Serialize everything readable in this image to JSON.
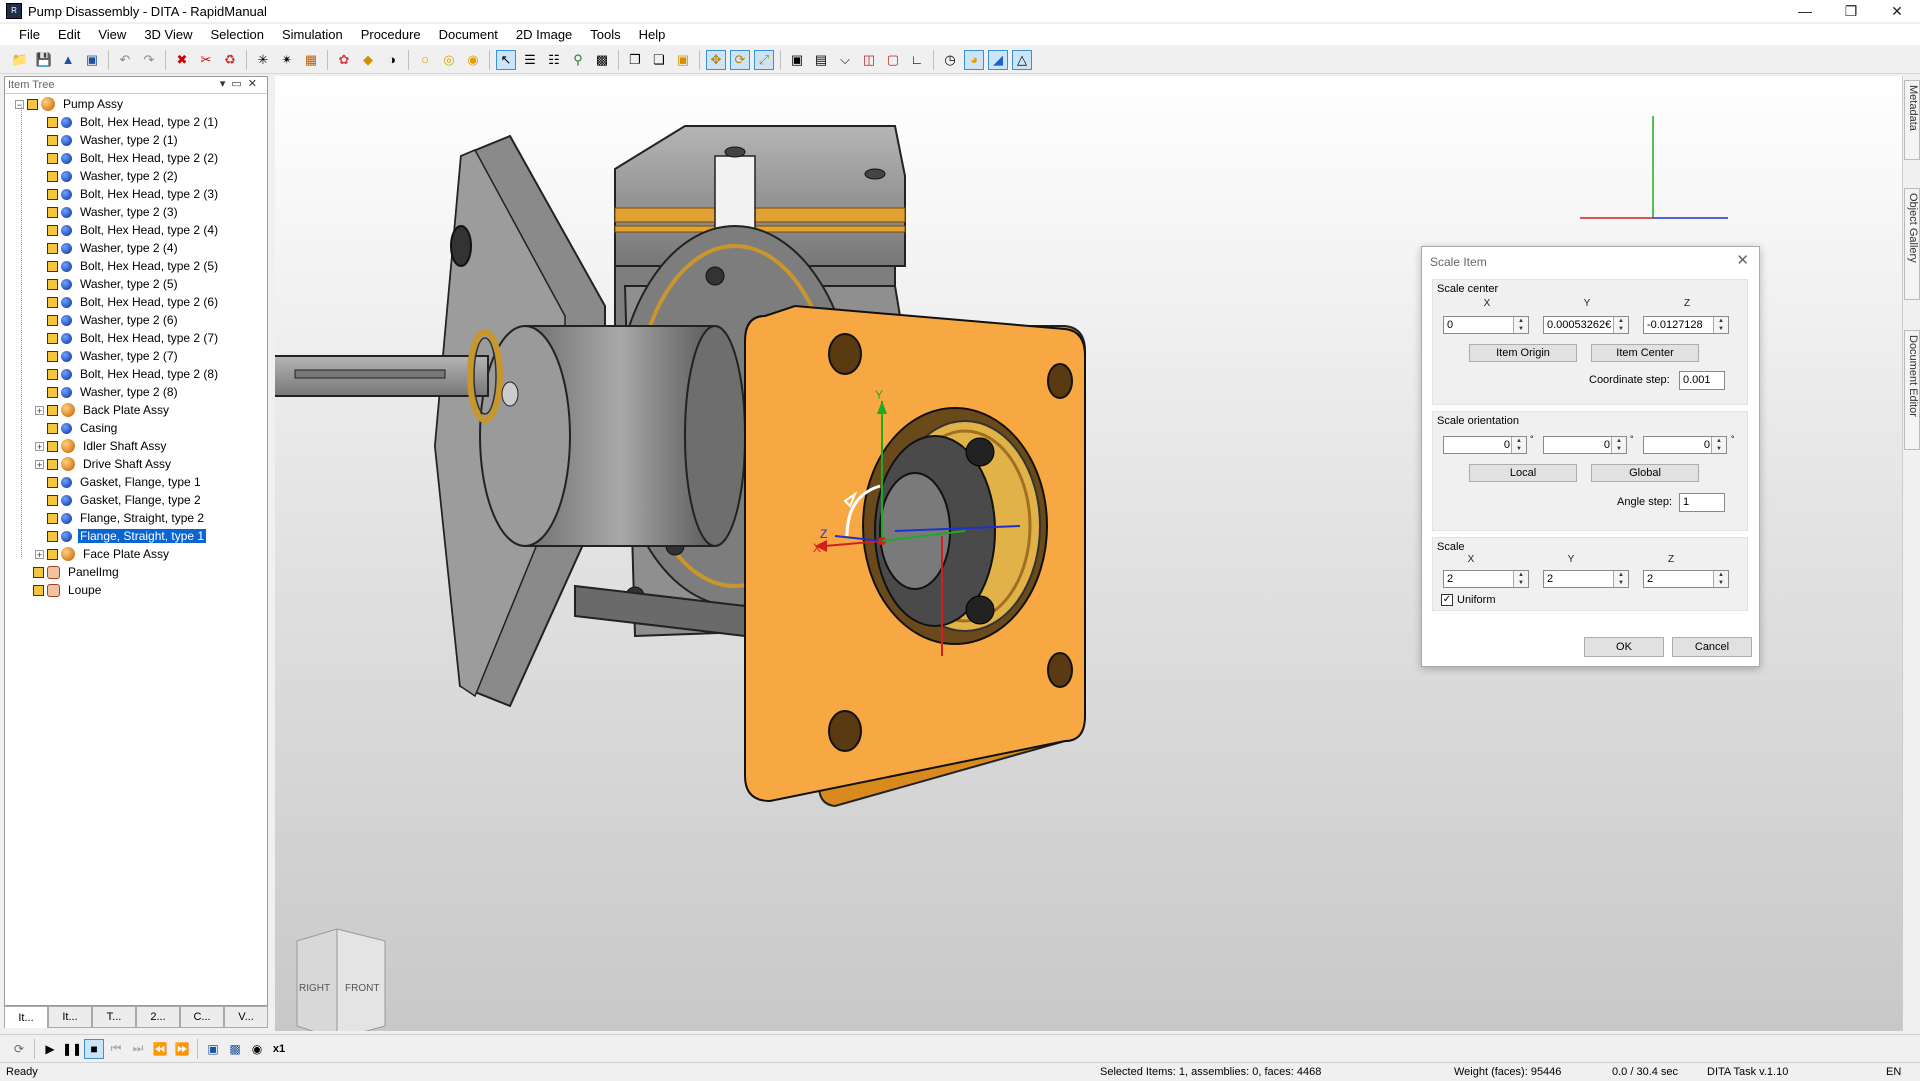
{
  "window": {
    "title": "Pump Disassembly - DITA - RapidManual"
  },
  "menu": [
    "File",
    "Edit",
    "View",
    "3D View",
    "Selection",
    "Simulation",
    "Procedure",
    "Document",
    "2D Image",
    "Tools",
    "Help"
  ],
  "tree_panel": {
    "header": "Item Tree",
    "root": "Pump Assy",
    "items": [
      {
        "label": "Bolt, Hex Head, type 2 (1)",
        "kind": "part"
      },
      {
        "label": "Washer, type 2 (1)",
        "kind": "part"
      },
      {
        "label": "Bolt, Hex Head, type 2 (2)",
        "kind": "part"
      },
      {
        "label": "Washer, type 2 (2)",
        "kind": "part"
      },
      {
        "label": "Bolt, Hex Head, type 2 (3)",
        "kind": "part"
      },
      {
        "label": "Washer, type 2 (3)",
        "kind": "part"
      },
      {
        "label": "Bolt, Hex Head, type 2 (4)",
        "kind": "part"
      },
      {
        "label": "Washer, type 2 (4)",
        "kind": "part"
      },
      {
        "label": "Bolt, Hex Head, type 2 (5)",
        "kind": "part"
      },
      {
        "label": "Washer, type 2 (5)",
        "kind": "part"
      },
      {
        "label": "Bolt, Hex Head, type 2 (6)",
        "kind": "part"
      },
      {
        "label": "Washer, type 2 (6)",
        "kind": "part"
      },
      {
        "label": "Bolt, Hex Head, type 2 (7)",
        "kind": "part"
      },
      {
        "label": "Washer, type 2 (7)",
        "kind": "part"
      },
      {
        "label": "Bolt, Hex Head, type 2 (8)",
        "kind": "part"
      },
      {
        "label": "Washer, type 2 (8)",
        "kind": "part"
      },
      {
        "label": "Back Plate Assy",
        "kind": "assy"
      },
      {
        "label": "Casing",
        "kind": "part"
      },
      {
        "label": "Idler Shaft Assy",
        "kind": "assy"
      },
      {
        "label": "Drive Shaft Assy",
        "kind": "assy"
      },
      {
        "label": "Gasket, Flange, type 1",
        "kind": "part"
      },
      {
        "label": "Gasket, Flange, type 2",
        "kind": "part"
      },
      {
        "label": "Flange, Straight, type 2",
        "kind": "part"
      },
      {
        "label": "Flange, Straight, type 1",
        "kind": "part",
        "selected": true
      },
      {
        "label": "Face Plate Assy",
        "kind": "assy"
      }
    ],
    "top_items": [
      "PanelImg",
      "Loupe"
    ],
    "tabs": [
      "It...",
      "It...",
      "T...",
      "2...",
      "C...",
      "V..."
    ]
  },
  "right_tabs": [
    "Metadata",
    "Object Gallery",
    "Document Editor"
  ],
  "navcube": {
    "right": "RIGHT",
    "front": "FRONT"
  },
  "gizmo": {
    "x": "X",
    "y": "Y",
    "z": "Z"
  },
  "dialog": {
    "title": "Scale Item",
    "scale_center": {
      "title": "Scale center",
      "x_label": "X",
      "y_label": "Y",
      "z_label": "Z",
      "x": "0",
      "y": "0.00053262€",
      "z": "-0.0127128",
      "item_origin": "Item Origin",
      "item_center": "Item Center",
      "coord_step_label": "Coordinate step:",
      "coord_step": "0.001"
    },
    "scale_orientation": {
      "title": "Scale orientation",
      "a": "0",
      "b": "0",
      "c": "0",
      "deg": "°",
      "local": "Local",
      "global": "Global",
      "angle_step_label": "Angle step:",
      "angle_step": "1"
    },
    "scale": {
      "title": "Scale",
      "x_label": "X",
      "y_label": "Y",
      "z_label": "Z",
      "x": "2",
      "y": "2",
      "z": "2",
      "uniform": "Uniform"
    },
    "ok": "OK",
    "cancel": "Cancel"
  },
  "status": {
    "ready": "Ready",
    "selected": "Selected Items: 1, assemblies: 0, faces: 4468",
    "weight": "Weight (faces): 95446",
    "time": "0.0 / 30.4 sec",
    "task": "DITA Task v.1.10",
    "lang": "EN"
  },
  "playbar": {
    "speed": "x1"
  },
  "colors": {
    "accent": "#0a64d2",
    "flange": "#f7a843",
    "selection": "#0a64d2"
  }
}
